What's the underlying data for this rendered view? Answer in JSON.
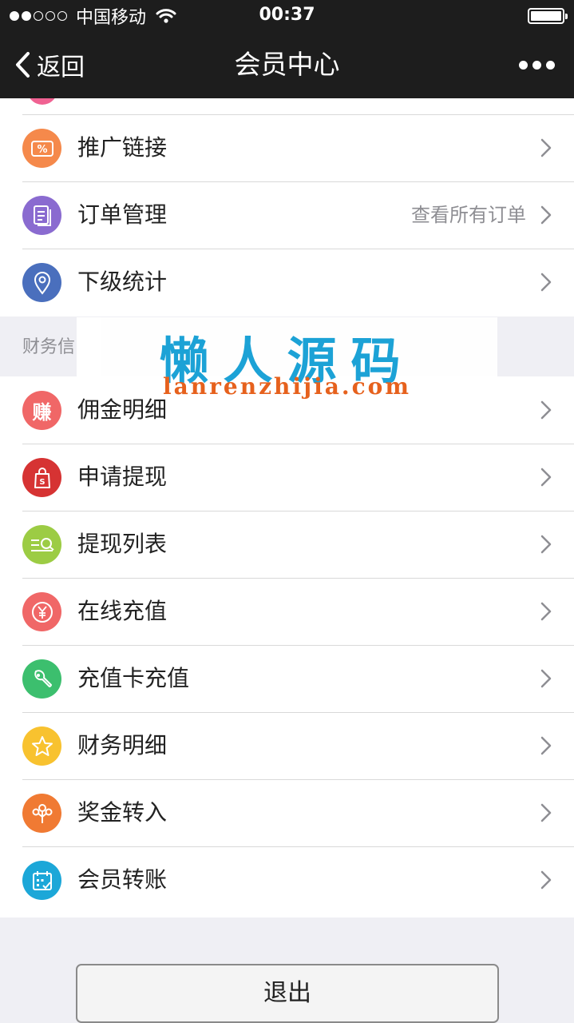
{
  "status": {
    "carrier": "中国移动",
    "time": "00:37"
  },
  "navbar": {
    "back_label": "返回",
    "title": "会员中心"
  },
  "top_list": [
    {
      "label": "推广链接",
      "icon": "coupon-icon",
      "color": "#f5894b",
      "note": ""
    },
    {
      "label": "订单管理",
      "icon": "document-icon",
      "color": "#8a6bd0",
      "note": "查看所有订单"
    },
    {
      "label": "下级统计",
      "icon": "location-pin-icon",
      "color": "#4a6fbd",
      "note": ""
    }
  ],
  "section": {
    "title": "财务信"
  },
  "watermark": {
    "title": "懒人源码",
    "url": "lanrenzhijia.com"
  },
  "finance_list": [
    {
      "label": "佣金明细",
      "icon": "earn-icon",
      "icon_text": "赚",
      "color": "#f06767"
    },
    {
      "label": "申请提现",
      "icon": "shopping-bag-icon",
      "color": "#d63333"
    },
    {
      "label": "提现列表",
      "icon": "list-search-icon",
      "color": "#9ccc44"
    },
    {
      "label": "在线充值",
      "icon": "yuan-coin-icon",
      "color": "#f06767"
    },
    {
      "label": "充值卡充值",
      "icon": "wrench-icon",
      "color": "#3cbf6e"
    },
    {
      "label": "财务明细",
      "icon": "star-icon",
      "color": "#f8c22f"
    },
    {
      "label": "奖金转入",
      "icon": "bonus-tree-icon",
      "color": "#f07a33"
    },
    {
      "label": "会员转账",
      "icon": "calendar-check-icon",
      "color": "#1ca7d8"
    }
  ],
  "logout_label": "退出"
}
